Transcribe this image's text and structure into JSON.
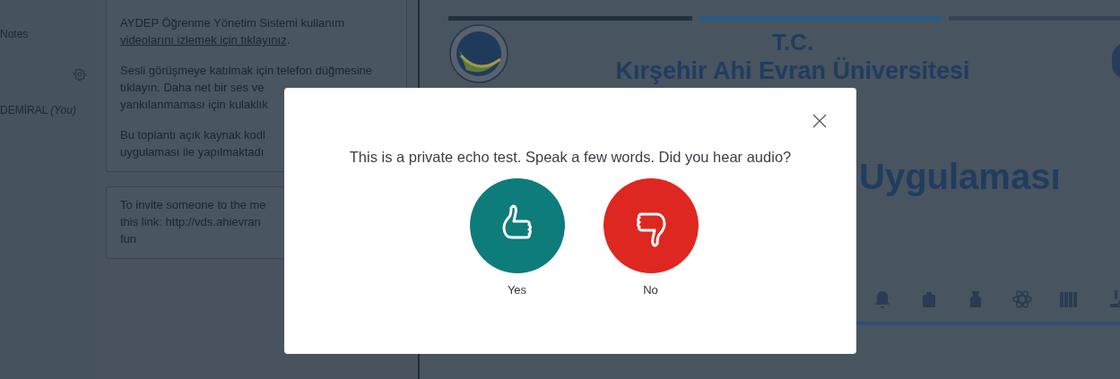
{
  "sidebar": {
    "notes_label": "Notes",
    "users": [
      {
        "name": "DEMİRAL *(You)*"
      }
    ]
  },
  "chat": {
    "messages": [
      {
        "paragraphs": [
          {
            "lines": [
              "AYDEP Öğrenme Yönetim Sistemi kullanım"
            ],
            "link": "videolarını izlemek için tıklayınız",
            "after": "."
          },
          {
            "lines": [
              "Sesli görüşmeye katılmak için telefon düğmesine",
              "tıklayın. Daha net bir ses ve",
              "yankılanmaması için kulaklık"
            ]
          },
          {
            "lines": [
              "Bu toplantı açık kaynak kodl",
              "uygulaması ile yapılmaktadı"
            ]
          }
        ]
      },
      {
        "paragraphs": [
          {
            "lines": [
              "To invite someone to the me",
              "this link: http://vds.ahievran",
              "fun"
            ]
          }
        ]
      }
    ]
  },
  "slide": {
    "heading": "T.C.",
    "subheading": "Kırşehir Ahi Evran Üniversitesi",
    "title": "Uygulaması"
  },
  "modal": {
    "message": "This is a private echo test. Speak a few words. Did you hear audio?",
    "answers": [
      {
        "kind": "yes",
        "label": "Yes"
      },
      {
        "kind": "no",
        "label": "No"
      }
    ]
  }
}
